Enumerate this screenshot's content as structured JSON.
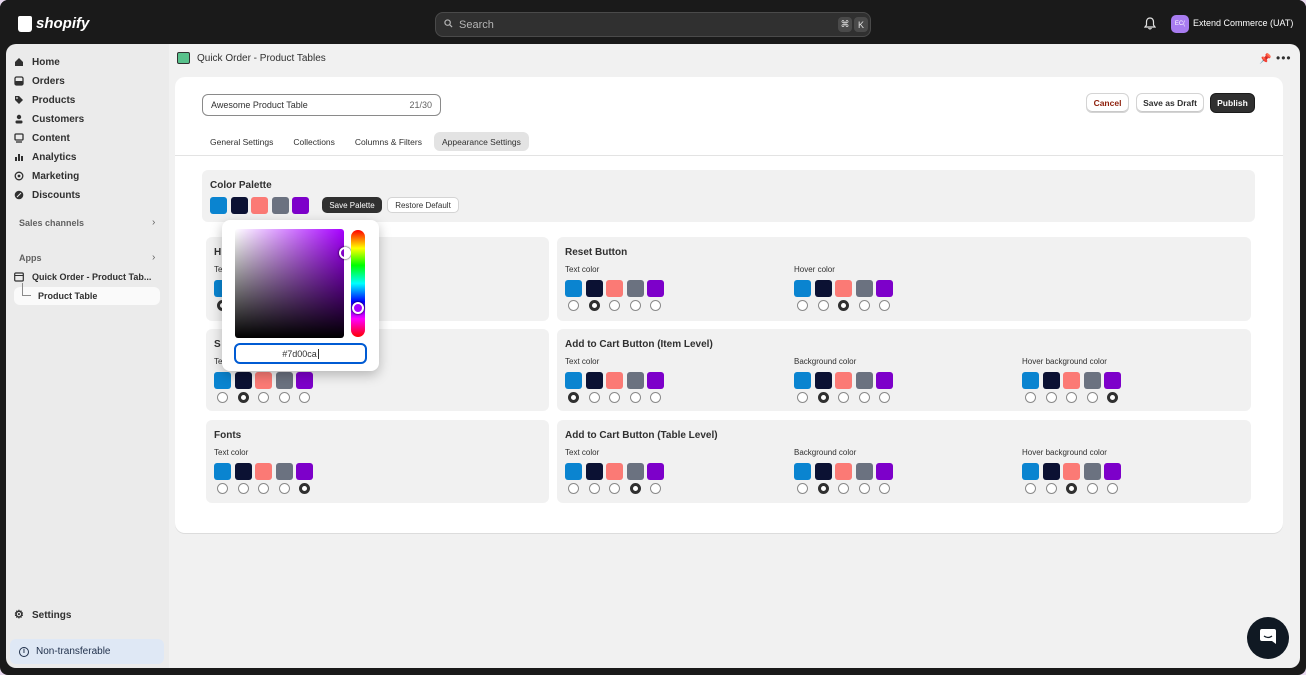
{
  "topbar": {
    "brand": "shopify",
    "search_placeholder": "Search",
    "shortcut_keys": [
      "⌘",
      "K"
    ],
    "store_initials": "EC(",
    "store_name": "Extend Commerce (UAT)"
  },
  "sidebar": {
    "items": [
      {
        "label": "Home",
        "icon": "home-icon"
      },
      {
        "label": "Orders",
        "icon": "inbox-icon"
      },
      {
        "label": "Products",
        "icon": "tag-icon"
      },
      {
        "label": "Customers",
        "icon": "person-icon"
      },
      {
        "label": "Content",
        "icon": "content-icon"
      },
      {
        "label": "Analytics",
        "icon": "bar-chart-icon"
      },
      {
        "label": "Marketing",
        "icon": "target-icon"
      },
      {
        "label": "Discounts",
        "icon": "discount-icon"
      }
    ],
    "sales_channels_label": "Sales channels",
    "apps_label": "Apps",
    "app_item": "Quick Order - Product Tab...",
    "app_subitem": "Product Table",
    "settings_label": "Settings",
    "notice_label": "Non-transferable"
  },
  "page": {
    "app_title": "Quick Order - Product Tables",
    "table_name": "Awesome Product Table",
    "char_count": "21/30",
    "cancel_label": "Cancel",
    "save_draft_label": "Save as Draft",
    "publish_label": "Publish",
    "tabs": [
      "General Settings",
      "Collections",
      "Columns & Filters",
      "Appearance Settings"
    ],
    "active_tab": "Appearance Settings"
  },
  "palette": {
    "title": "Color Palette",
    "colors": [
      "#0a84d0",
      "#0b1133",
      "#fb7a75",
      "#6b7280",
      "#7d00ca"
    ],
    "save_label": "Save Palette",
    "restore_label": "Restore Default"
  },
  "color_picker": {
    "hex_value": "#7d00ca"
  },
  "panels": [
    {
      "title": "H",
      "fields": [
        {
          "label": "Te",
          "selected": 0
        }
      ]
    },
    {
      "title": "Reset Button",
      "fields": [
        {
          "label": "Text color",
          "selected": 1
        },
        {
          "label": "Hover color",
          "selected": 2
        }
      ]
    },
    {
      "title": "S",
      "fields": [
        {
          "label": "Te",
          "selected": 1
        }
      ]
    },
    {
      "title": "Add to Cart Button (Item Level)",
      "fields": [
        {
          "label": "Text color",
          "selected": 0
        },
        {
          "label": "Background color",
          "selected": 1
        },
        {
          "label": "Hover background color",
          "selected": 4
        }
      ]
    },
    {
      "title": "Fonts",
      "fields": [
        {
          "label": "Text color",
          "selected": 4
        }
      ]
    },
    {
      "title": "Add to Cart Button (Table Level)",
      "fields": [
        {
          "label": "Text color",
          "selected": 3
        },
        {
          "label": "Background color",
          "selected": 1
        },
        {
          "label": "Hover background color",
          "selected": 2
        }
      ]
    }
  ]
}
